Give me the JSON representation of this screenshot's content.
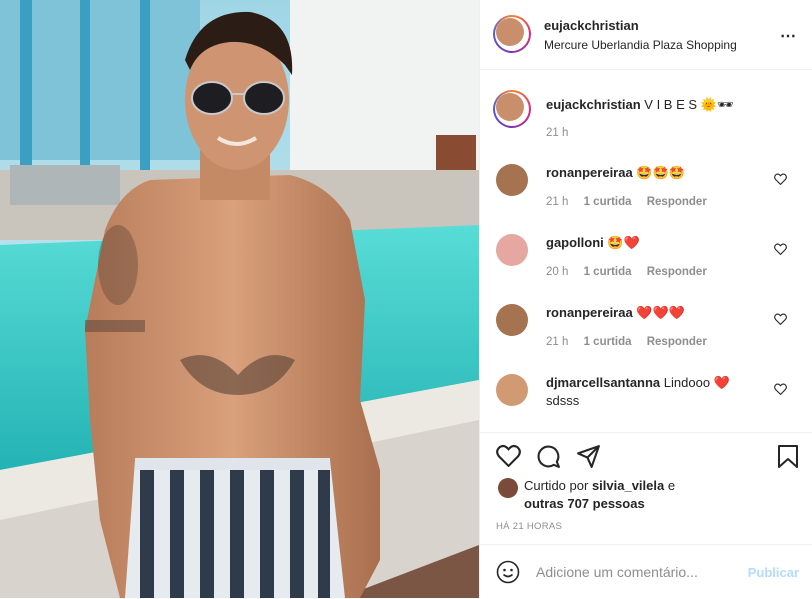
{
  "post": {
    "username": "eujackchristian",
    "location": "Mercure Uberlandia Plaza Shopping",
    "more_icon": "⋯"
  },
  "caption": {
    "username": "eujackchristian",
    "text": "V I B E S 🌞🕶",
    "time": "21 h"
  },
  "comments": [
    {
      "username": "ronanpereiraa",
      "text": "🤩🤩🤩",
      "time": "21 h",
      "likes": "1 curtida",
      "reply": "Responder"
    },
    {
      "username": "gapolloni",
      "text": "🤩❤️",
      "time": "20 h",
      "likes": "1 curtida",
      "reply": "Responder"
    },
    {
      "username": "ronanpereiraa",
      "text": "❤️❤️❤️",
      "time": "21 h",
      "likes": "1 curtida",
      "reply": "Responder"
    },
    {
      "username": "djmarcellsantanna",
      "text": "Lindooo ❤️",
      "text2": "sdsss"
    }
  ],
  "liked_by": {
    "prefix": "Curtido por",
    "user": "silvia_vilela",
    "conj": "e",
    "others": "outras 707 pessoas"
  },
  "timestamp": "HÁ 21 HORAS",
  "add_comment": {
    "placeholder": "Adicione um comentário...",
    "publish": "Publicar",
    "emoji_icon": "smiley-icon"
  },
  "colors": {
    "pool": "#39c9c9",
    "link_blue": "#b3dbff",
    "heart_red": "#ed4956"
  }
}
